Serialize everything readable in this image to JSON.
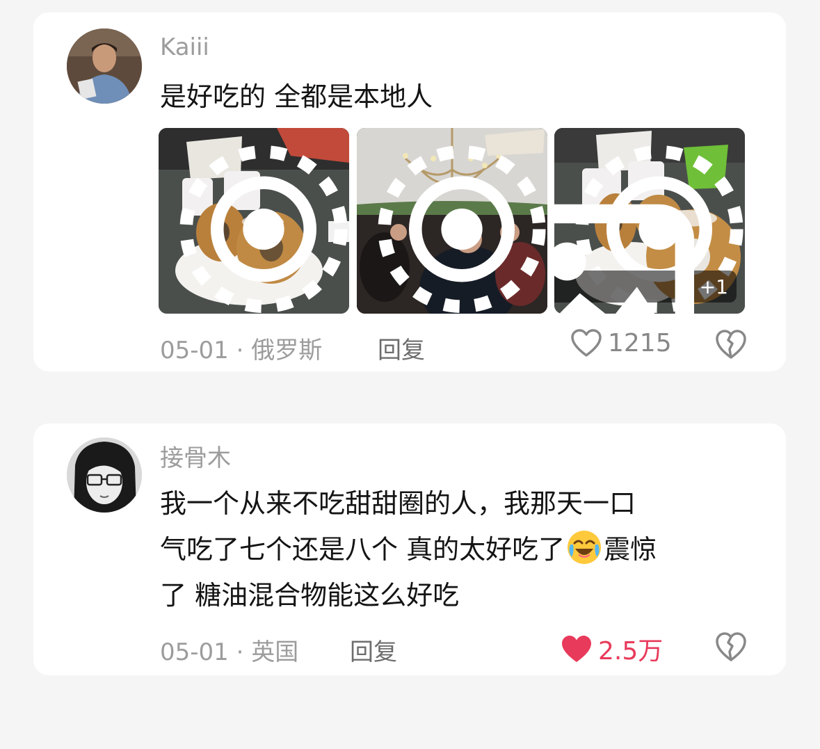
{
  "comments": [
    {
      "author": "Kaiii",
      "text": "是好吃的 全都是本地人",
      "photo_more_count": "+1",
      "meta": "05-01 · 俄罗斯",
      "reply_label": "回复",
      "likes": "1215",
      "liked": false
    },
    {
      "author": "接骨木",
      "text_line1": "我一个从来不吃甜甜圈的人，我那天一口",
      "text_line2a": "气吃了七个还是八个 真的太好吃了",
      "text_line2b": "震惊",
      "text_line3": "了 糖油混合物能这么好吃",
      "meta": "05-01 · 英国",
      "reply_label": "回复",
      "likes": "2.5万",
      "liked": true
    }
  ],
  "colors": {
    "background": "#f5f5f5",
    "card": "#ffffff",
    "secondary_text": "#9c9c9c",
    "primary_text": "#141414",
    "liked_red": "#e83a5b"
  },
  "icons": [
    "live-photo-icon",
    "image-icon",
    "heart-outline-icon",
    "heart-filled-icon",
    "broken-heart-icon",
    "crying-laughing-emoji"
  ]
}
